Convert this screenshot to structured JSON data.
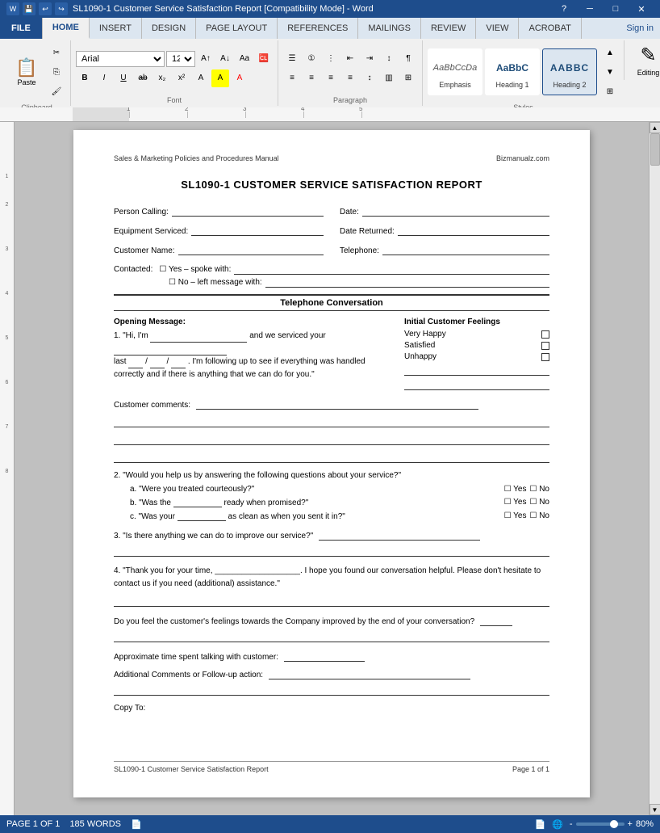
{
  "titleBar": {
    "title": "SL1090-1 Customer Service Satisfaction Report [Compatibility Mode] - Word",
    "helpIcon": "?",
    "minimizeBtn": "─",
    "maximizeBtn": "□",
    "closeBtn": "✕"
  },
  "ribbonTabs": [
    {
      "label": "FILE",
      "type": "file"
    },
    {
      "label": "HOME",
      "active": true
    },
    {
      "label": "INSERT"
    },
    {
      "label": "DESIGN"
    },
    {
      "label": "PAGE LAYOUT"
    },
    {
      "label": "REFERENCES"
    },
    {
      "label": "MAILINGS"
    },
    {
      "label": "REVIEW"
    },
    {
      "label": "VIEW"
    },
    {
      "label": "ACROBAT"
    }
  ],
  "ribbon": {
    "fontFamily": "Arial",
    "fontSize": "12",
    "styles": [
      {
        "name": "Emphasis",
        "preview": "AaBbCcDa",
        "previewStyle": "italic"
      },
      {
        "name": "Heading 1",
        "preview": "AaBbC",
        "previewStyle": "bold-blue"
      },
      {
        "name": "Heading 2",
        "preview": "AABBCC",
        "previewStyle": "bold-blue-active"
      },
      {
        "name": "Editing",
        "preview": "✎",
        "previewStyle": "editing"
      }
    ],
    "groups": [
      "Clipboard",
      "Font",
      "Paragraph",
      "Styles"
    ]
  },
  "document": {
    "headerLeft": "Sales & Marketing Policies and Procedures Manual",
    "headerRight": "Bizmanualz.com",
    "title": "SL1090-1 CUSTOMER SERVICE SATISFACTION REPORT",
    "fields": {
      "personCalling": "Person Calling:",
      "date": "Date:",
      "equipmentServiced": "Equipment Serviced:",
      "dateReturned": "Date Returned:",
      "customerName": "Customer Name:",
      "telephone": "Telephone:",
      "contacted": "Contacted:"
    },
    "contactOptions": [
      "☐  Yes – spoke with:",
      "☐  No – left message with:"
    ],
    "sectionTitle": "Telephone Conversation",
    "openingMessage": "Opening Message:",
    "openingText1": "1. \"Hi, I'm",
    "openingText2": "and we serviced your",
    "openingText3": "last",
    "openingText4": ". I'm following up to see if everything was handled correctly and if there is anything that we can do for you.\"",
    "customerComments": "Customer comments:",
    "initialFeelings": "Initial Customer Feelings",
    "feelings": [
      {
        "label": "Very Happy",
        "checked": false
      },
      {
        "label": "Satisfied",
        "checked": false
      },
      {
        "label": "Unhappy",
        "checked": false
      }
    ],
    "question2": "2. \"Would you help us by answering the following questions about your service?\"",
    "questions": [
      {
        "text": "a.  \"Were you treated courteously?\""
      },
      {
        "text": "b.  \"Was the _________ ready when promised?\""
      },
      {
        "text": "c.  \"Was your _________ as clean as when you sent it in?\""
      }
    ],
    "question3label": "3. \"Is there anything we can do to improve our service?\"",
    "question4label": "4. \"Thank you for your time, ___________________. I hope you found our conversation helpful. Please don't hesitate to contact us if you need (additional) assistance.\"",
    "improvedLabel": "Do you feel the customer's feelings towards the Company improved by the end of your conversation?",
    "approxTime": "Approximate time spent talking with customer:",
    "additionalComments": "Additional Comments or Follow-up action:",
    "copyTo": "Copy To:",
    "footerLeft": "SL1090-1 Customer Service Satisfaction Report",
    "footerRight": "Page 1 of 1"
  },
  "statusBar": {
    "pageInfo": "PAGE 1 OF 1",
    "wordCount": "185 WORDS",
    "zoomLevel": "80%",
    "signIn": "Sign in"
  }
}
